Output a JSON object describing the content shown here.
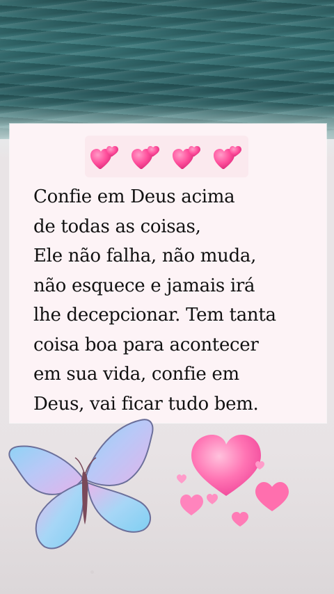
{
  "message": {
    "text": "Confie em Deus acima\nde todas as coisas,\nEle não falha, não muda,\nnão esquece e jamais irá\nlhe decepcionar. Tem tanta\ncoisa boa para acontecer\nem sua vida, confie em\nDeus, vai ficar tudo bem."
  },
  "decorations": {
    "top_hearts": [
      "two-hearts-icon",
      "two-hearts-icon",
      "two-hearts-icon",
      "two-hearts-icon"
    ],
    "butterfly": "butterfly-icon",
    "heart_cluster": "pink-hearts-icon"
  },
  "colors": {
    "sea": "#2f5f62",
    "card": "#fdf3f6",
    "heart_pink": "#ff5ea8",
    "text": "#111111"
  }
}
